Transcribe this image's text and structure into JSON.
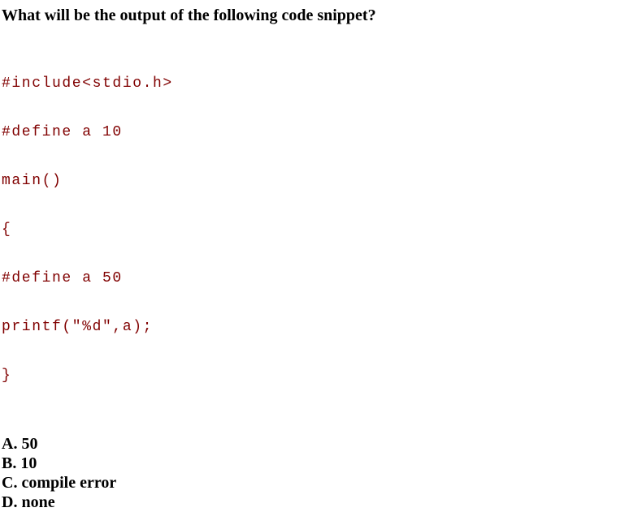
{
  "question": "What will be the output of the following code snippet?",
  "code_lines": [
    "#include<stdio.h>",
    "#define a 10",
    "main()",
    "{",
    "#define a 50",
    "printf(\"%d\",a);",
    "}"
  ],
  "options": [
    "A. 50",
    "B. 10",
    "C. compile error",
    "D. none"
  ],
  "colors": {
    "code_text": "#800000",
    "question_text": "#000000",
    "background": "#ffffff"
  }
}
